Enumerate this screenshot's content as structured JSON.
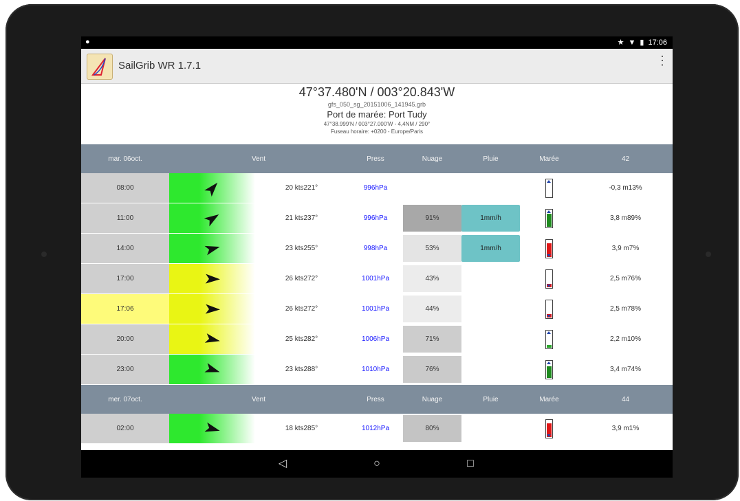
{
  "statusbar": {
    "time": "17:06",
    "star": "★",
    "wifi": "▼",
    "battery": "▮"
  },
  "app": {
    "title": "SailGrib WR 1.7.1",
    "overflow": "⋮"
  },
  "header": {
    "coords": "47°37.480'N / 003°20.843'W",
    "file": "gfs_050_sg_20151006_141945.grb",
    "port": "Port de marée: Port Tudy",
    "port_pos": "47°38.999'N / 003°27.000'W - 4,4NM / 290°",
    "timezone": "Fuseau horaire: +0200 - Europe/Paris"
  },
  "day_headers": [
    {
      "date": "mar. 06",
      "month": "oct.",
      "vent": "Vent",
      "press": "Press",
      "nuage": "Nuage",
      "pluie": "Pluie",
      "maree": "Marée",
      "coef": "42"
    },
    {
      "date": "mer. 07",
      "month": "oct.",
      "vent": "Vent",
      "press": "Press",
      "nuage": "Nuage",
      "pluie": "Pluie",
      "maree": "Marée",
      "coef": "44"
    }
  ],
  "rows": [
    {
      "time": "08:00",
      "speed": "20 kts",
      "dir": "221°",
      "dir_deg": 221,
      "wind_color": "#2ee82e",
      "press": "996",
      "unit": "hPa",
      "cloud": "",
      "cloud_bg": "#ffffff",
      "rain": "",
      "rain_unit": "",
      "tide_fill": "#ffffff",
      "tide_level": 0.1,
      "tide_dir": "up",
      "tide_height": "-0,3 m",
      "tide_pct": "13%"
    },
    {
      "time": "11:00",
      "speed": "21 kts",
      "dir": "237°",
      "dir_deg": 237,
      "wind_color": "#2ee82e",
      "press": "996",
      "unit": "hPa",
      "cloud": "91%",
      "cloud_bg": "#a8a8a8",
      "rain": "1",
      "rain_unit": "mm/h",
      "tide_fill": "#1e8a1e",
      "tide_level": 0.8,
      "tide_dir": "up",
      "tide_height": "3,8 m",
      "tide_pct": "89%"
    },
    {
      "time": "14:00",
      "speed": "23 kts",
      "dir": "255°",
      "dir_deg": 255,
      "wind_color": "#2ee82e",
      "press": "998",
      "unit": "hPa",
      "cloud": "53%",
      "cloud_bg": "#e4e4e4",
      "rain": "1",
      "rain_unit": "mm/h",
      "tide_fill": "#e01515",
      "tide_level": 0.85,
      "tide_dir": "down",
      "tide_height": "3,9 m",
      "tide_pct": "7%"
    },
    {
      "time": "17:00",
      "speed": "26 kts",
      "dir": "272°",
      "dir_deg": 272,
      "wind_color": "#e9f514",
      "press": "1001",
      "unit": "hPa",
      "cloud": "43%",
      "cloud_bg": "#ececec",
      "rain": "",
      "rain_unit": "",
      "tide_fill": "#e01515",
      "tide_level": 0.2,
      "tide_dir": "down",
      "tide_height": "2,5 m",
      "tide_pct": "76%"
    },
    {
      "time": "17:06",
      "speed": "26 kts",
      "dir": "272°",
      "dir_deg": 272,
      "wind_color": "#e9f514",
      "press": "1001",
      "unit": "hPa",
      "cloud": "44%",
      "cloud_bg": "#ececec",
      "rain": "",
      "rain_unit": "",
      "tide_fill": "#e01515",
      "tide_level": 0.2,
      "tide_dir": "down",
      "tide_height": "2,5 m",
      "tide_pct": "78%",
      "now": true
    },
    {
      "time": "20:00",
      "speed": "25 kts",
      "dir": "282°",
      "dir_deg": 282,
      "wind_color": "#e9f514",
      "press": "1006",
      "unit": "hPa",
      "cloud": "71%",
      "cloud_bg": "#cdcdcd",
      "rain": "",
      "rain_unit": "",
      "tide_fill": "#2ea82e",
      "tide_level": 0.15,
      "tide_dir": "up",
      "tide_height": "2,2 m",
      "tide_pct": "10%"
    },
    {
      "time": "23:00",
      "speed": "23 kts",
      "dir": "288°",
      "dir_deg": 288,
      "wind_color": "#2ee82e",
      "press": "1010",
      "unit": "hPa",
      "cloud": "76%",
      "cloud_bg": "#cacaca",
      "rain": "",
      "rain_unit": "",
      "tide_fill": "#1e8a1e",
      "tide_level": 0.7,
      "tide_dir": "up",
      "tide_height": "3,4 m",
      "tide_pct": "74%"
    },
    {
      "time": "02:00",
      "speed": "18 kts",
      "dir": "285°",
      "dir_deg": 285,
      "wind_color": "#2ee82e",
      "press": "1012",
      "unit": "hPa",
      "cloud": "80%",
      "cloud_bg": "#c4c4c4",
      "rain": "",
      "rain_unit": "",
      "tide_fill": "#e01515",
      "tide_level": 0.85,
      "tide_dir": "down",
      "tide_height": "3,9 m",
      "tide_pct": "1%"
    }
  ],
  "navbar": {
    "back": "◁",
    "home": "○",
    "recents": "□"
  }
}
